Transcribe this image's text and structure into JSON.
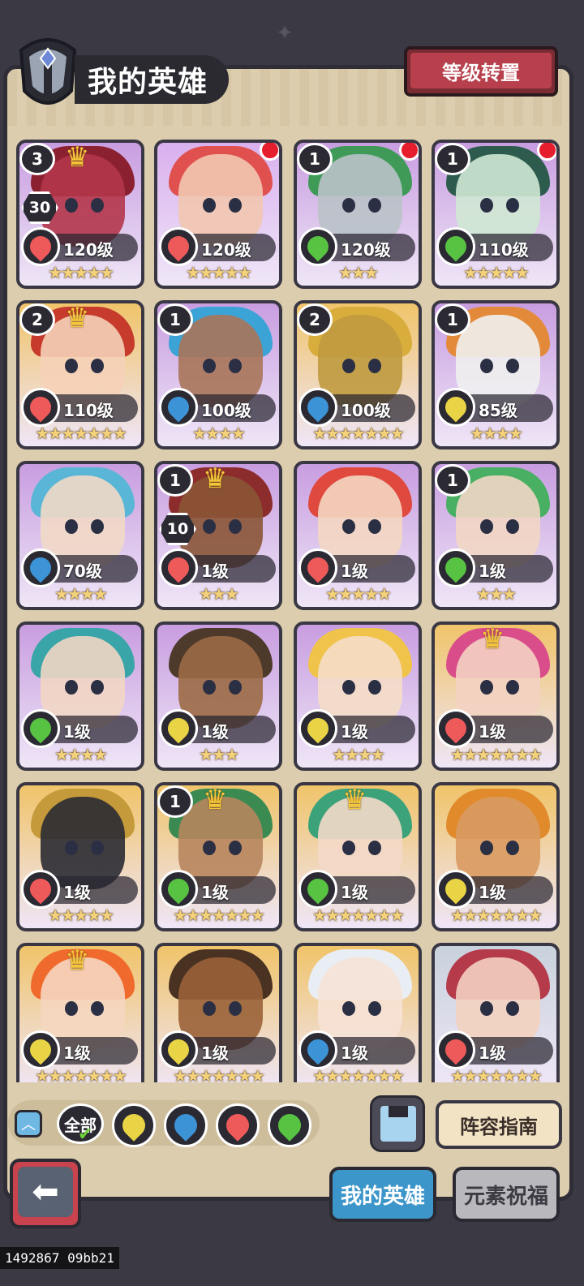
{
  "header": {
    "title": "我的英雄",
    "level_transfer_label": "等级转置"
  },
  "heroes": [
    {
      "level": "120级",
      "stars": 5,
      "element": "fire",
      "badge": "3",
      "level_badge": "30",
      "crown": true,
      "red_dot": false,
      "bg": "#c89de0",
      "face": "#b3364a",
      "hair": "#8b2030"
    },
    {
      "level": "120级",
      "stars": 5,
      "element": "fire",
      "badge": "",
      "level_badge": "",
      "crown": false,
      "red_dot": true,
      "bg": "#d9b0ee",
      "face": "#f2c7b0",
      "hair": "#e0504f"
    },
    {
      "level": "120级",
      "stars": 3,
      "element": "wood",
      "badge": "1",
      "level_badge": "",
      "crown": false,
      "red_dot": true,
      "bg": "#c89de0",
      "face": "#b9c2c8",
      "hair": "#3f9a58"
    },
    {
      "level": "110级",
      "stars": 5,
      "element": "wood",
      "badge": "1",
      "level_badge": "",
      "crown": false,
      "red_dot": true,
      "bg": "#c89de0",
      "face": "#cfe8d4",
      "hair": "#2d5c4e"
    },
    {
      "level": "110级",
      "stars": 7,
      "element": "fire",
      "badge": "2",
      "level_badge": "",
      "crown": true,
      "red_dot": false,
      "bg": "#f0c46a",
      "face": "#f5d1b8",
      "hair": "#c63b2c"
    },
    {
      "level": "100级",
      "stars": 4,
      "element": "water",
      "badge": "1",
      "level_badge": "",
      "crown": false,
      "red_dot": false,
      "bg": "#c89de0",
      "face": "#a9765a",
      "hair": "#3ca3d6"
    },
    {
      "level": "100级",
      "stars": 7,
      "element": "water",
      "badge": "2",
      "level_badge": "",
      "crown": false,
      "red_dot": false,
      "bg": "#f0c46a",
      "face": "#c09a40",
      "hair": "#d9ad3c"
    },
    {
      "level": "85级",
      "stars": 4,
      "element": "earth",
      "badge": "1",
      "level_badge": "",
      "crown": false,
      "red_dot": false,
      "bg": "#c89de0",
      "face": "#f0f0f0",
      "hair": "#e38a3a"
    },
    {
      "level": "70级",
      "stars": 4,
      "element": "water",
      "badge": "",
      "level_badge": "",
      "crown": false,
      "red_dot": false,
      "bg": "#c89de0",
      "face": "#f1d9c7",
      "hair": "#59b6d6"
    },
    {
      "level": "1级",
      "stars": 3,
      "element": "fire",
      "badge": "1",
      "level_badge": "10",
      "crown": true,
      "red_dot": false,
      "bg": "#c89de0",
      "face": "#8a5536",
      "hair": "#8c2c2c"
    },
    {
      "level": "1级",
      "stars": 5,
      "element": "fire",
      "badge": "",
      "level_badge": "",
      "crown": false,
      "red_dot": false,
      "bg": "#c89de0",
      "face": "#f4d7c2",
      "hair": "#e0493e"
    },
    {
      "level": "1级",
      "stars": 3,
      "element": "wood",
      "badge": "1",
      "level_badge": "",
      "crown": false,
      "red_dot": false,
      "bg": "#c89de0",
      "face": "#f2d6c4",
      "hair": "#49b063"
    },
    {
      "level": "1级",
      "stars": 4,
      "element": "wood",
      "badge": "",
      "level_badge": "",
      "crown": false,
      "red_dot": false,
      "bg": "#c89de0",
      "face": "#f2d6c4",
      "hair": "#3aa5a8"
    },
    {
      "level": "1级",
      "stars": 3,
      "element": "earth",
      "badge": "",
      "level_badge": "",
      "crown": false,
      "red_dot": false,
      "bg": "#c89de0",
      "face": "#9c6a45",
      "hair": "#4d3a2a"
    },
    {
      "level": "1级",
      "stars": 4,
      "element": "earth",
      "badge": "",
      "level_badge": "",
      "crown": false,
      "red_dot": false,
      "bg": "#c89de0",
      "face": "#f5ddc8",
      "hair": "#f0c34a"
    },
    {
      "level": "1级",
      "stars": 7,
      "element": "fire",
      "badge": "",
      "level_badge": "",
      "crown": true,
      "red_dot": false,
      "bg": "#f0c46a",
      "face": "#f3d2c2",
      "hair": "#d94d8a"
    },
    {
      "level": "1级",
      "stars": 5,
      "element": "fire",
      "badge": "",
      "level_badge": "",
      "crown": false,
      "red_dot": false,
      "bg": "#f0c46a",
      "face": "#2a2b33",
      "hair": "#c59a3a"
    },
    {
      "level": "1级",
      "stars": 7,
      "element": "wood",
      "badge": "1",
      "level_badge": "",
      "crown": true,
      "red_dot": false,
      "bg": "#f0c46a",
      "face": "#b7855e",
      "hair": "#3a8a52"
    },
    {
      "level": "1级",
      "stars": 7,
      "element": "wood",
      "badge": "",
      "level_badge": "",
      "crown": true,
      "red_dot": false,
      "bg": "#f0c46a",
      "face": "#f3d9c8",
      "hair": "#3ca27a"
    },
    {
      "level": "1级",
      "stars": 7,
      "element": "earth",
      "badge": "",
      "level_badge": "",
      "crown": false,
      "red_dot": false,
      "bg": "#f0c46a",
      "face": "#d99a62",
      "hair": "#e08a2c"
    },
    {
      "level": "1级",
      "stars": 7,
      "element": "earth",
      "badge": "",
      "level_badge": "",
      "crown": true,
      "red_dot": false,
      "bg": "#f0c46a",
      "face": "#f5d6c0",
      "hair": "#ef6a2c"
    },
    {
      "level": "1级",
      "stars": 7,
      "element": "earth",
      "badge": "",
      "level_badge": "",
      "crown": false,
      "red_dot": false,
      "bg": "#f0c46a",
      "face": "#9a6238",
      "hair": "#4a3222"
    },
    {
      "level": "1级",
      "stars": 7,
      "element": "water",
      "badge": "",
      "level_badge": "",
      "crown": false,
      "red_dot": false,
      "bg": "#f0c46a",
      "face": "#f6e2d6",
      "hair": "#e9eef5"
    },
    {
      "level": "1级",
      "stars": 7,
      "element": "fire",
      "badge": "",
      "level_badge": "",
      "crown": false,
      "red_dot": false,
      "bg": "#c8d2dc",
      "face": "#f3d2c0",
      "hair": "#b53a4a"
    }
  ],
  "element_colors": {
    "fire": "#ee5a5a",
    "wood": "#58c243",
    "water": "#3c93d6",
    "earth": "#e9d445"
  },
  "filter": {
    "up_icon": "chevron-up-icon",
    "all_label": "全部",
    "elements": [
      "earth",
      "water",
      "fire",
      "wood"
    ]
  },
  "save_icon": "floppy-disk-icon",
  "lineup_guide_label": "阵容指南",
  "back_icon": "back-arrow-icon",
  "tabs": {
    "my_heroes": "我的英雄",
    "element_blessing": "元素祝福"
  },
  "overlay_text": "1492867 09bb21"
}
